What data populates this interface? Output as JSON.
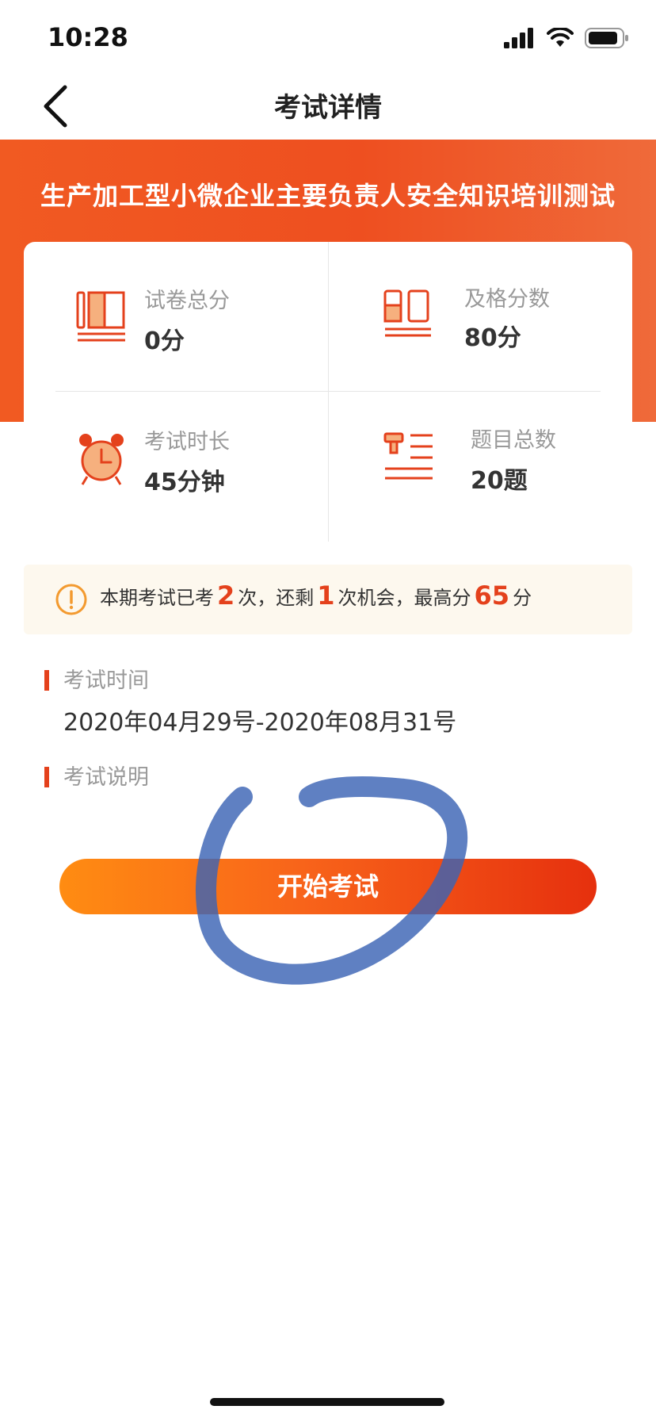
{
  "status_bar": {
    "time": "10:28"
  },
  "nav": {
    "title": "考试详情"
  },
  "exam": {
    "title": "生产加工型小微企业主要负责人安全知识培训测试"
  },
  "stats": {
    "total_score": {
      "label": "试卷总分",
      "value": "0分",
      "icon": "book-columns-icon"
    },
    "pass_score": {
      "label": "及格分数",
      "value": "80分",
      "icon": "score-60-icon"
    },
    "duration": {
      "label": "考试时长",
      "value": "45分钟",
      "icon": "alarm-clock-icon"
    },
    "question_count": {
      "label": "题目总数",
      "value": "20题",
      "icon": "question-list-icon"
    }
  },
  "notice": {
    "icon": "exclamation-circle-icon",
    "part1": "本期考试已考",
    "attempts_taken": "2",
    "part2": "次，还剩",
    "attempts_left": "1",
    "part3": "次机会，最高分",
    "highest_score": "65",
    "part4": "分"
  },
  "sections": {
    "time_label": "考试时间",
    "time_range": "2020年04月29号-2020年08月31号",
    "description_label": "考试说明"
  },
  "actions": {
    "start_label": "开始考试"
  },
  "colors": {
    "accent": "#e4411c",
    "banner": "#f15a22",
    "button_start": "#ff8c12",
    "button_end": "#e6300e",
    "notice_bg": "#fdf8ee",
    "scribble": "#3c64b4"
  }
}
